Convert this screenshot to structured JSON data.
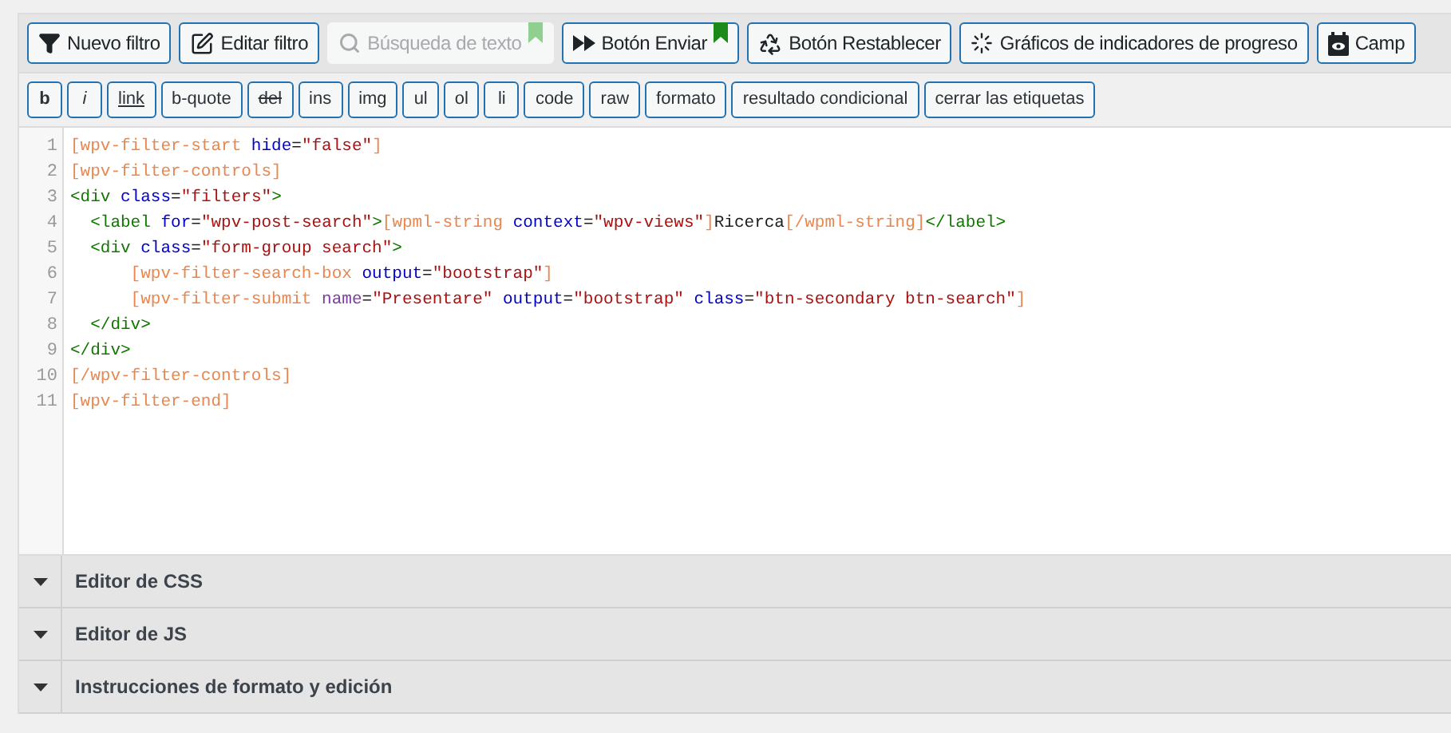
{
  "toolbar": [
    {
      "kind": "filter",
      "label": "Nuevo filtro",
      "disabled": false
    },
    {
      "kind": "edit",
      "label": "Editar filtro",
      "disabled": false
    },
    {
      "kind": "search",
      "label": "Búsqueda de texto",
      "disabled": true,
      "color": "#8fcf8f"
    },
    {
      "kind": "submit",
      "label": "Botón Enviar",
      "disabled": false,
      "color": "#1b8a1b"
    },
    {
      "kind": "reset",
      "label": "Botón Restablecer",
      "disabled": false
    },
    {
      "kind": "progress",
      "label": "Gráficos de indicadores de progreso",
      "disabled": false
    },
    {
      "kind": "field",
      "label": "Camp",
      "disabled": false
    }
  ],
  "format_buttons": [
    {
      "kind": "bold",
      "label": "b"
    },
    {
      "kind": "italic",
      "label": "i"
    },
    {
      "kind": "underline",
      "label": "link"
    },
    {
      "kind": "plain",
      "label": "b-quote"
    },
    {
      "kind": "strike",
      "label": "del"
    },
    {
      "kind": "plain",
      "label": "ins"
    },
    {
      "kind": "plain",
      "label": "img"
    },
    {
      "kind": "plain",
      "label": "ul"
    },
    {
      "kind": "plain",
      "label": "ol"
    },
    {
      "kind": "plain",
      "label": "li"
    },
    {
      "kind": "plain",
      "label": "code"
    },
    {
      "kind": "plain",
      "label": "raw"
    },
    {
      "kind": "plain",
      "label": "formato"
    },
    {
      "kind": "plain",
      "label": "resultado condicional"
    },
    {
      "kind": "plain",
      "label": "cerrar las etiquetas"
    }
  ],
  "editor": {
    "lines": [
      {
        "number": "1",
        "tokens": [
          {
            "kind": "sc",
            "text": "[wpv-filter-start"
          },
          {
            "kind": "attr",
            "text": " hide"
          },
          {
            "kind": "text",
            "text": "="
          },
          {
            "kind": "str",
            "text": "\"false\""
          },
          {
            "kind": "sc",
            "text": "]"
          }
        ]
      },
      {
        "number": "2",
        "tokens": [
          {
            "kind": "sc",
            "text": "[wpv-filter-controls]"
          }
        ]
      },
      {
        "number": "3",
        "tokens": [
          {
            "kind": "tag",
            "text": "<div"
          },
          {
            "kind": "attr",
            "text": " class"
          },
          {
            "kind": "text",
            "text": "="
          },
          {
            "kind": "str",
            "text": "\"filters\""
          },
          {
            "kind": "tag",
            "text": ">"
          }
        ]
      },
      {
        "number": "4",
        "tokens": [
          {
            "kind": "tag",
            "text": "  <label"
          },
          {
            "kind": "attr",
            "text": " for"
          },
          {
            "kind": "text",
            "text": "="
          },
          {
            "kind": "str",
            "text": "\"wpv-post-search\""
          },
          {
            "kind": "tag",
            "text": ">"
          },
          {
            "kind": "sc",
            "text": "[wpml-string"
          },
          {
            "kind": "attr",
            "text": " context"
          },
          {
            "kind": "text",
            "text": "="
          },
          {
            "kind": "str",
            "text": "\"wpv-views\""
          },
          {
            "kind": "sc",
            "text": "]"
          },
          {
            "kind": "text",
            "text": "Ricerca"
          },
          {
            "kind": "sc",
            "text": "[/wpml-string]"
          },
          {
            "kind": "tag",
            "text": "</label>"
          }
        ]
      },
      {
        "number": "5",
        "tokens": [
          {
            "kind": "tag",
            "text": "  <div"
          },
          {
            "kind": "attr",
            "text": " class"
          },
          {
            "kind": "text",
            "text": "="
          },
          {
            "kind": "str",
            "text": "\"form-group search\""
          },
          {
            "kind": "tag",
            "text": ">"
          }
        ]
      },
      {
        "number": "6",
        "tokens": [
          {
            "kind": "sc",
            "text": "      [wpv-filter-search-box"
          },
          {
            "kind": "attr",
            "text": " output"
          },
          {
            "kind": "text",
            "text": "="
          },
          {
            "kind": "str",
            "text": "\"bootstrap\""
          },
          {
            "kind": "sc",
            "text": "]"
          }
        ]
      },
      {
        "number": "7",
        "tokens": [
          {
            "kind": "sc",
            "text": "      [wpv-filter-submit"
          },
          {
            "kind": "attr2",
            "text": " name"
          },
          {
            "kind": "text",
            "text": "="
          },
          {
            "kind": "str",
            "text": "\"Presentare\""
          },
          {
            "kind": "attr",
            "text": " output"
          },
          {
            "kind": "text",
            "text": "="
          },
          {
            "kind": "str",
            "text": "\"bootstrap\""
          },
          {
            "kind": "attr",
            "text": " class"
          },
          {
            "kind": "text",
            "text": "="
          },
          {
            "kind": "str",
            "text": "\"btn-secondary btn-search\""
          },
          {
            "kind": "sc",
            "text": "]"
          }
        ]
      },
      {
        "number": "8",
        "tokens": [
          {
            "kind": "tag",
            "text": "  </div>"
          }
        ]
      },
      {
        "number": "9",
        "tokens": [
          {
            "kind": "tag",
            "text": "</div>"
          }
        ]
      },
      {
        "number": "10",
        "tokens": [
          {
            "kind": "sc",
            "text": "[/wpv-filter-controls]"
          }
        ]
      },
      {
        "number": "11",
        "tokens": [
          {
            "kind": "sc",
            "text": "[wpv-filter-end]"
          }
        ]
      }
    ]
  },
  "panels": [
    {
      "title": "Editor de CSS",
      "expanded": false
    },
    {
      "title": "Editor de JS",
      "expanded": false
    },
    {
      "title": "Instrucciones de formato y edición",
      "expanded": false
    }
  ]
}
